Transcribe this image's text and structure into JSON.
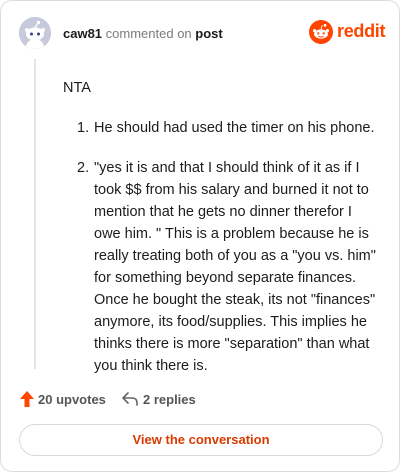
{
  "header": {
    "username": "caw81",
    "commented_on": "commented on",
    "post_link": "post",
    "brand": "reddit"
  },
  "comment": {
    "intro": "NTA",
    "items": [
      {
        "number": "1.",
        "text": "He should had used the timer on his phone."
      },
      {
        "number": "2.",
        "text": "\"yes it is and that I should think of it as if I took $$ from his salary and burned it not to mention that he gets no dinner therefor I owe him. \" This is a problem because he is really treating both of you as a \"you vs. him\" for something beyond separate finances. Once he bought the steak, its not \"finances\" anymore, its food/supplies. This implies he thinks there is more \"separation\" than what you think there is."
      }
    ]
  },
  "actions": {
    "upvotes": "20 upvotes",
    "replies": "2 replies",
    "view_label": "View the conversation"
  },
  "colors": {
    "brand": "#ff4500",
    "link": "#d93a00",
    "avatar_bg": "#c7c9dd"
  },
  "icons": {
    "avatar": "snoo-avatar-icon",
    "logo": "reddit-logo-icon",
    "upvote": "upvote-arrow-icon",
    "reply": "reply-arrow-icon"
  }
}
